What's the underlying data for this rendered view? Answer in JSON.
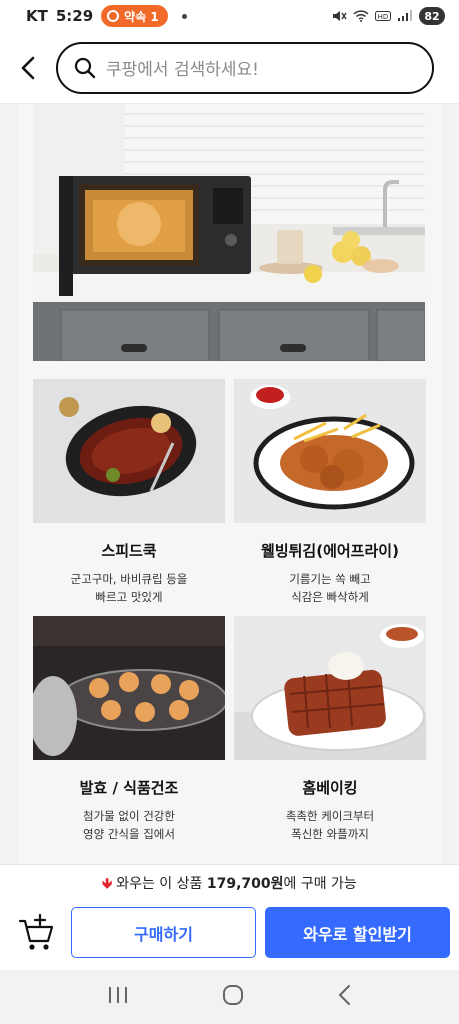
{
  "status": {
    "carrier": "KT",
    "time": "5:29",
    "pill_label": "약속 1",
    "battery": "82"
  },
  "search": {
    "placeholder": "쿠팡에서 검색하세요!"
  },
  "features": [
    {
      "title": "스피드쿡",
      "line1": "군고구마, 바비큐립 등을",
      "line2": "빠르고 맛있게"
    },
    {
      "title": "웰빙튀김(에어프라이)",
      "line1": "기름기는 쏙 빼고",
      "line2": "식감은 빠삭하게"
    },
    {
      "title": "발효 / 식품건조",
      "line1": "첨가물 없이 건강한",
      "line2": "영양 간식을 집에서"
    },
    {
      "title": "홈베이킹",
      "line1": "촉촉한 케이크부터",
      "line2": "폭신한 와플까지"
    }
  ],
  "promo": {
    "prefix": "와우는 이 상품 ",
    "price": "179,700원",
    "suffix": "에 구매 가능"
  },
  "buttons": {
    "buy": "구매하기",
    "wow": "와우로 할인받기"
  },
  "colors": {
    "accent": "#346aff",
    "promo_arrow": "#e4232b",
    "notification_pill": "#f26a2a"
  }
}
